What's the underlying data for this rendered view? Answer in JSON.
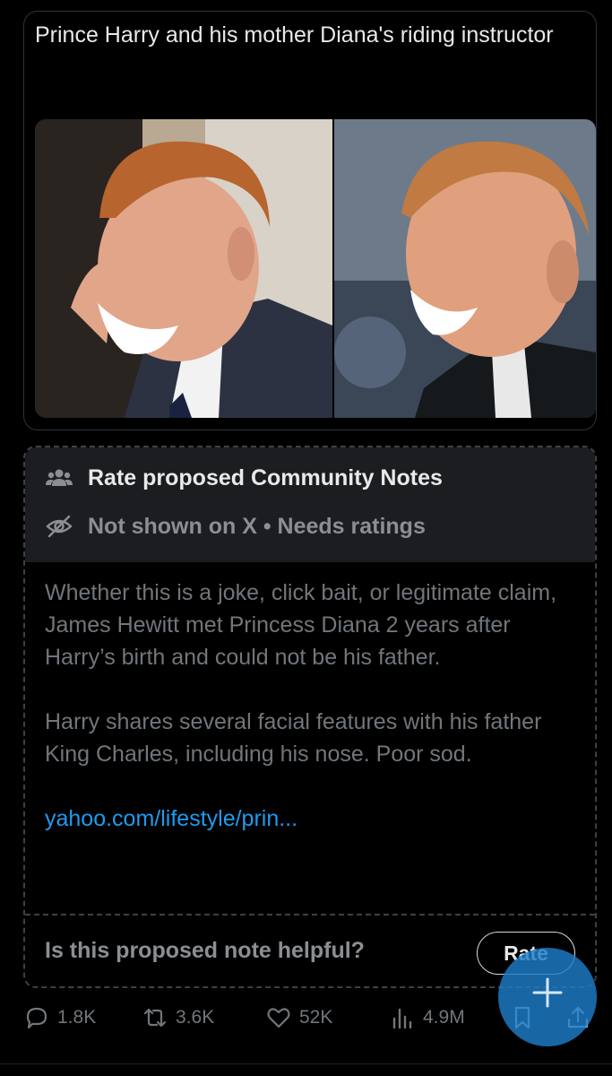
{
  "quoted_post": {
    "text": "Prince Harry and his mother Diana's riding instructor"
  },
  "community_notes": {
    "title": "Rate proposed Community Notes",
    "title_icon": "people-icon",
    "status": "Not shown on X • Needs ratings",
    "status_icon": "eye-off-icon",
    "body_paragraph_1": "Whether this is a joke, click bait, or legitimate claim, James Hewitt met Princess Diana 2 years after Harry’s birth and could not be his father.",
    "body_paragraph_2": "Harry shares several facial features with his father King Charles, including his nose. Poor sod.",
    "link": "yahoo.com/lifestyle/prin...",
    "helpful_question": "Is this proposed note helpful?",
    "rate_label": "Rate"
  },
  "actions": {
    "replies": "1.8K",
    "reposts": "3.6K",
    "likes": "52K",
    "views": "4.9M"
  },
  "colors": {
    "link": "#1d9bf0",
    "fab": "#1d7dc8",
    "muted": "#71767b"
  }
}
